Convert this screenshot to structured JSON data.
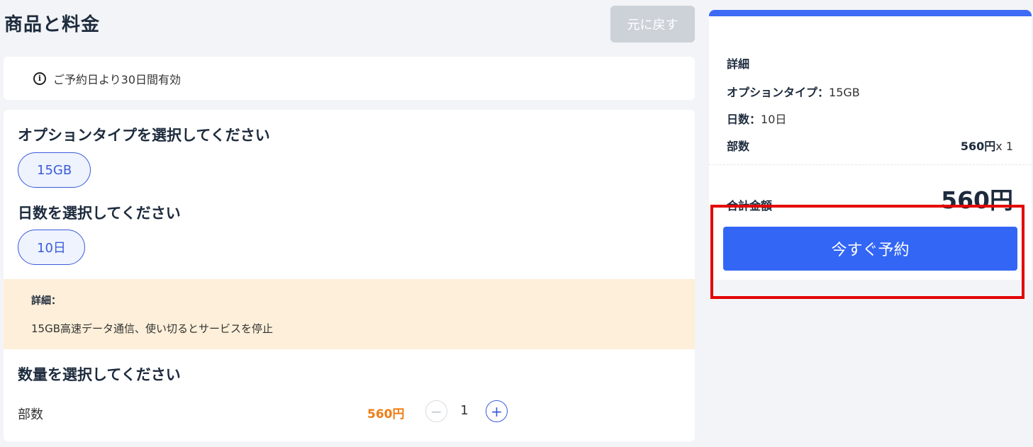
{
  "header": {
    "title": "商品と料金",
    "back_label": "元に戻す"
  },
  "validity": {
    "icon": "info-icon",
    "text": "ご予約日より30日間有効"
  },
  "option_type": {
    "heading": "オプションタイプを選択してください",
    "selected": "15GB"
  },
  "days": {
    "heading": "日数を選択してください",
    "selected": "10日"
  },
  "details": {
    "label": "詳細：",
    "text": "15GB高速データ通信、使い切るとサービスを停止"
  },
  "quantity": {
    "heading": "数量を選択してください",
    "label": "部数",
    "unit_price": "560円",
    "minus": "−",
    "value": "1",
    "plus": "+"
  },
  "summary": {
    "title": "詳細",
    "option_label": "オプションタイプ：",
    "option_value": "15GB",
    "days_label": "日数：",
    "days_value": "10日",
    "count_label": "部数",
    "count_price": "560円",
    "count_multiplier": "x 1",
    "total_label": "合計金額",
    "total_value": "560円",
    "book_label": "今すぐ予約"
  },
  "colors": {
    "accent": "#3366f5",
    "price_orange": "#f07c13",
    "details_bg": "#fdefd9",
    "highlight": "#e30000"
  }
}
